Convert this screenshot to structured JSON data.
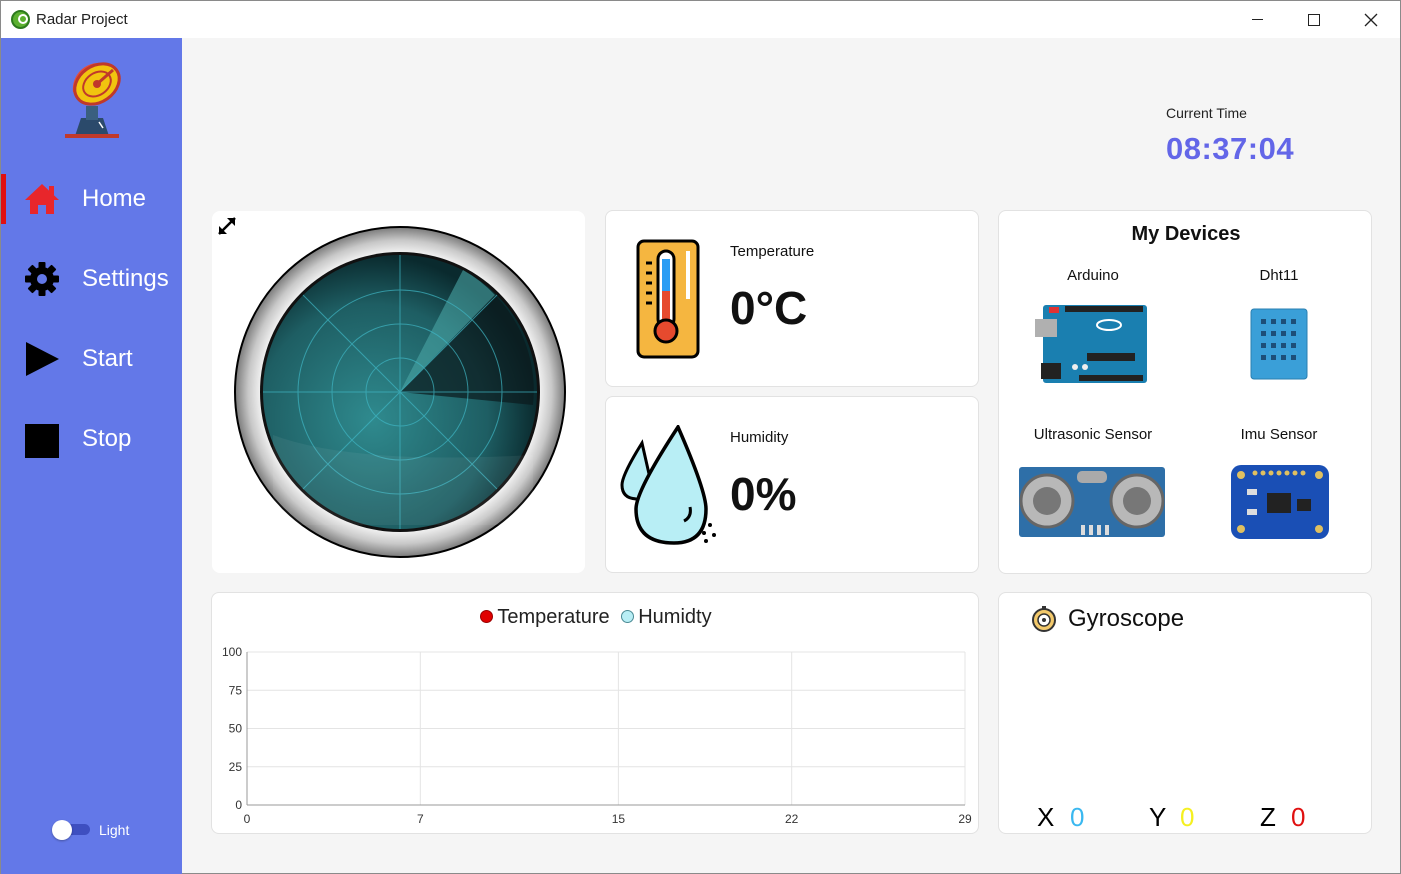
{
  "window": {
    "title": "Radar Project"
  },
  "sidebar": {
    "items": [
      {
        "label": "Home",
        "icon": "home-icon"
      },
      {
        "label": "Settings",
        "icon": "gear-icon"
      },
      {
        "label": "Start",
        "icon": "play-icon"
      },
      {
        "label": "Stop",
        "icon": "stop-icon"
      }
    ],
    "active": "Home",
    "theme_toggle_label": "Light",
    "theme_toggle_on": false
  },
  "header": {
    "time_label": "Current Time",
    "time_value": "08:37:04"
  },
  "temperature": {
    "label": "Temperature",
    "value": "0°C"
  },
  "humidity": {
    "label": "Humidity",
    "value": "0%"
  },
  "devices": {
    "title": "My Devices",
    "items": [
      {
        "label": "Arduino"
      },
      {
        "label": "Dht11"
      },
      {
        "label": "Ultrasonic Sensor"
      },
      {
        "label": "Imu Sensor"
      }
    ]
  },
  "gyroscope": {
    "title": "Gyroscope",
    "x_label": "X",
    "x_value": "0",
    "y_label": "Y",
    "y_value": "0",
    "z_label": "Z",
    "z_value": "0"
  },
  "colors": {
    "sidebar": "#6378e8",
    "accent": "#6366e8",
    "active_marker": "#e01010",
    "temperature_series": "#e00000",
    "humidity_series": "#b8eef5",
    "x_value": "#3ab8f0",
    "y_value": "#f5f020",
    "z_value": "#e01010"
  },
  "chart_data": {
    "type": "line",
    "series": [
      {
        "name": "Temperature",
        "values": []
      },
      {
        "name": "Humidty",
        "values": []
      }
    ],
    "x_ticks": [
      0,
      7,
      15,
      22,
      29
    ],
    "y_ticks": [
      0,
      25,
      50,
      75,
      100
    ],
    "xlim": [
      0,
      29
    ],
    "ylim": [
      0,
      100
    ],
    "grid": true,
    "legend_position": "top-center"
  }
}
